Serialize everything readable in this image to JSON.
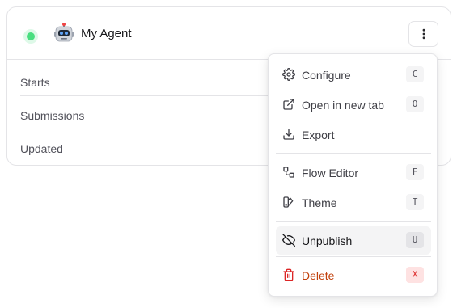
{
  "agent": {
    "name": "My Agent",
    "status_color": "#4ade80",
    "avatar_icon": "robot-icon"
  },
  "stats": [
    {
      "label": "Starts"
    },
    {
      "label": "Submissions"
    },
    {
      "label": "Updated"
    }
  ],
  "more_button": {
    "icon": "more-vertical-icon"
  },
  "menu": {
    "items": [
      {
        "label": "Configure",
        "shortcut": "C",
        "icon": "gear-icon"
      },
      {
        "label": "Open in new tab",
        "shortcut": "O",
        "icon": "external-link-icon"
      },
      {
        "label": "Export",
        "icon": "download-icon"
      },
      {
        "label": "Flow Editor",
        "shortcut": "F",
        "icon": "flow-icon"
      },
      {
        "label": "Theme",
        "shortcut": "T",
        "icon": "palette-icon"
      },
      {
        "label": "Unpublish",
        "shortcut": "U",
        "icon": "eye-off-icon"
      },
      {
        "label": "Delete",
        "shortcut": "X",
        "icon": "trash-icon"
      }
    ]
  },
  "colors": {
    "danger": "#c2410c",
    "border": "#e4e4e7",
    "active_bg": "#f4f4f5"
  }
}
